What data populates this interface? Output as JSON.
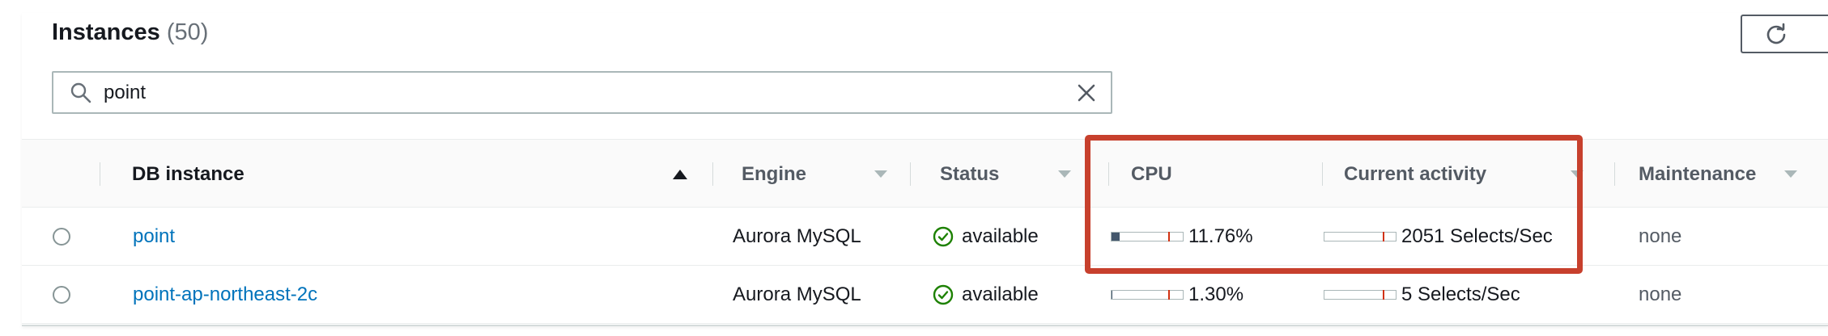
{
  "header": {
    "title": "Instances",
    "count": "(50)",
    "refresh_icon": "refresh-icon"
  },
  "search": {
    "value": "point",
    "icon": "search-icon",
    "clear_icon": "close-icon"
  },
  "columns": {
    "db_instance": "DB instance",
    "engine": "Engine",
    "status": "Status",
    "cpu": "CPU",
    "current_activity": "Current activity",
    "maintenance": "Maintenance"
  },
  "rows": [
    {
      "name": "point",
      "engine": "Aurora MySQL",
      "status": "available",
      "cpu": "11.76%",
      "cpu_fraction": 0.1176,
      "activity": "2051 Selects/Sec",
      "maintenance": "none"
    },
    {
      "name": "point-ap-northeast-2c",
      "engine": "Aurora MySQL",
      "status": "available",
      "cpu": "1.30%",
      "cpu_fraction": 0.013,
      "activity": "5 Selects/Sec",
      "maintenance": "none"
    }
  ],
  "colors": {
    "link": "#0073bb",
    "status_ok": "#1d8102",
    "highlight": "#c7402d",
    "bar_tick": "#d13212",
    "bar_fill": "#44576c"
  }
}
